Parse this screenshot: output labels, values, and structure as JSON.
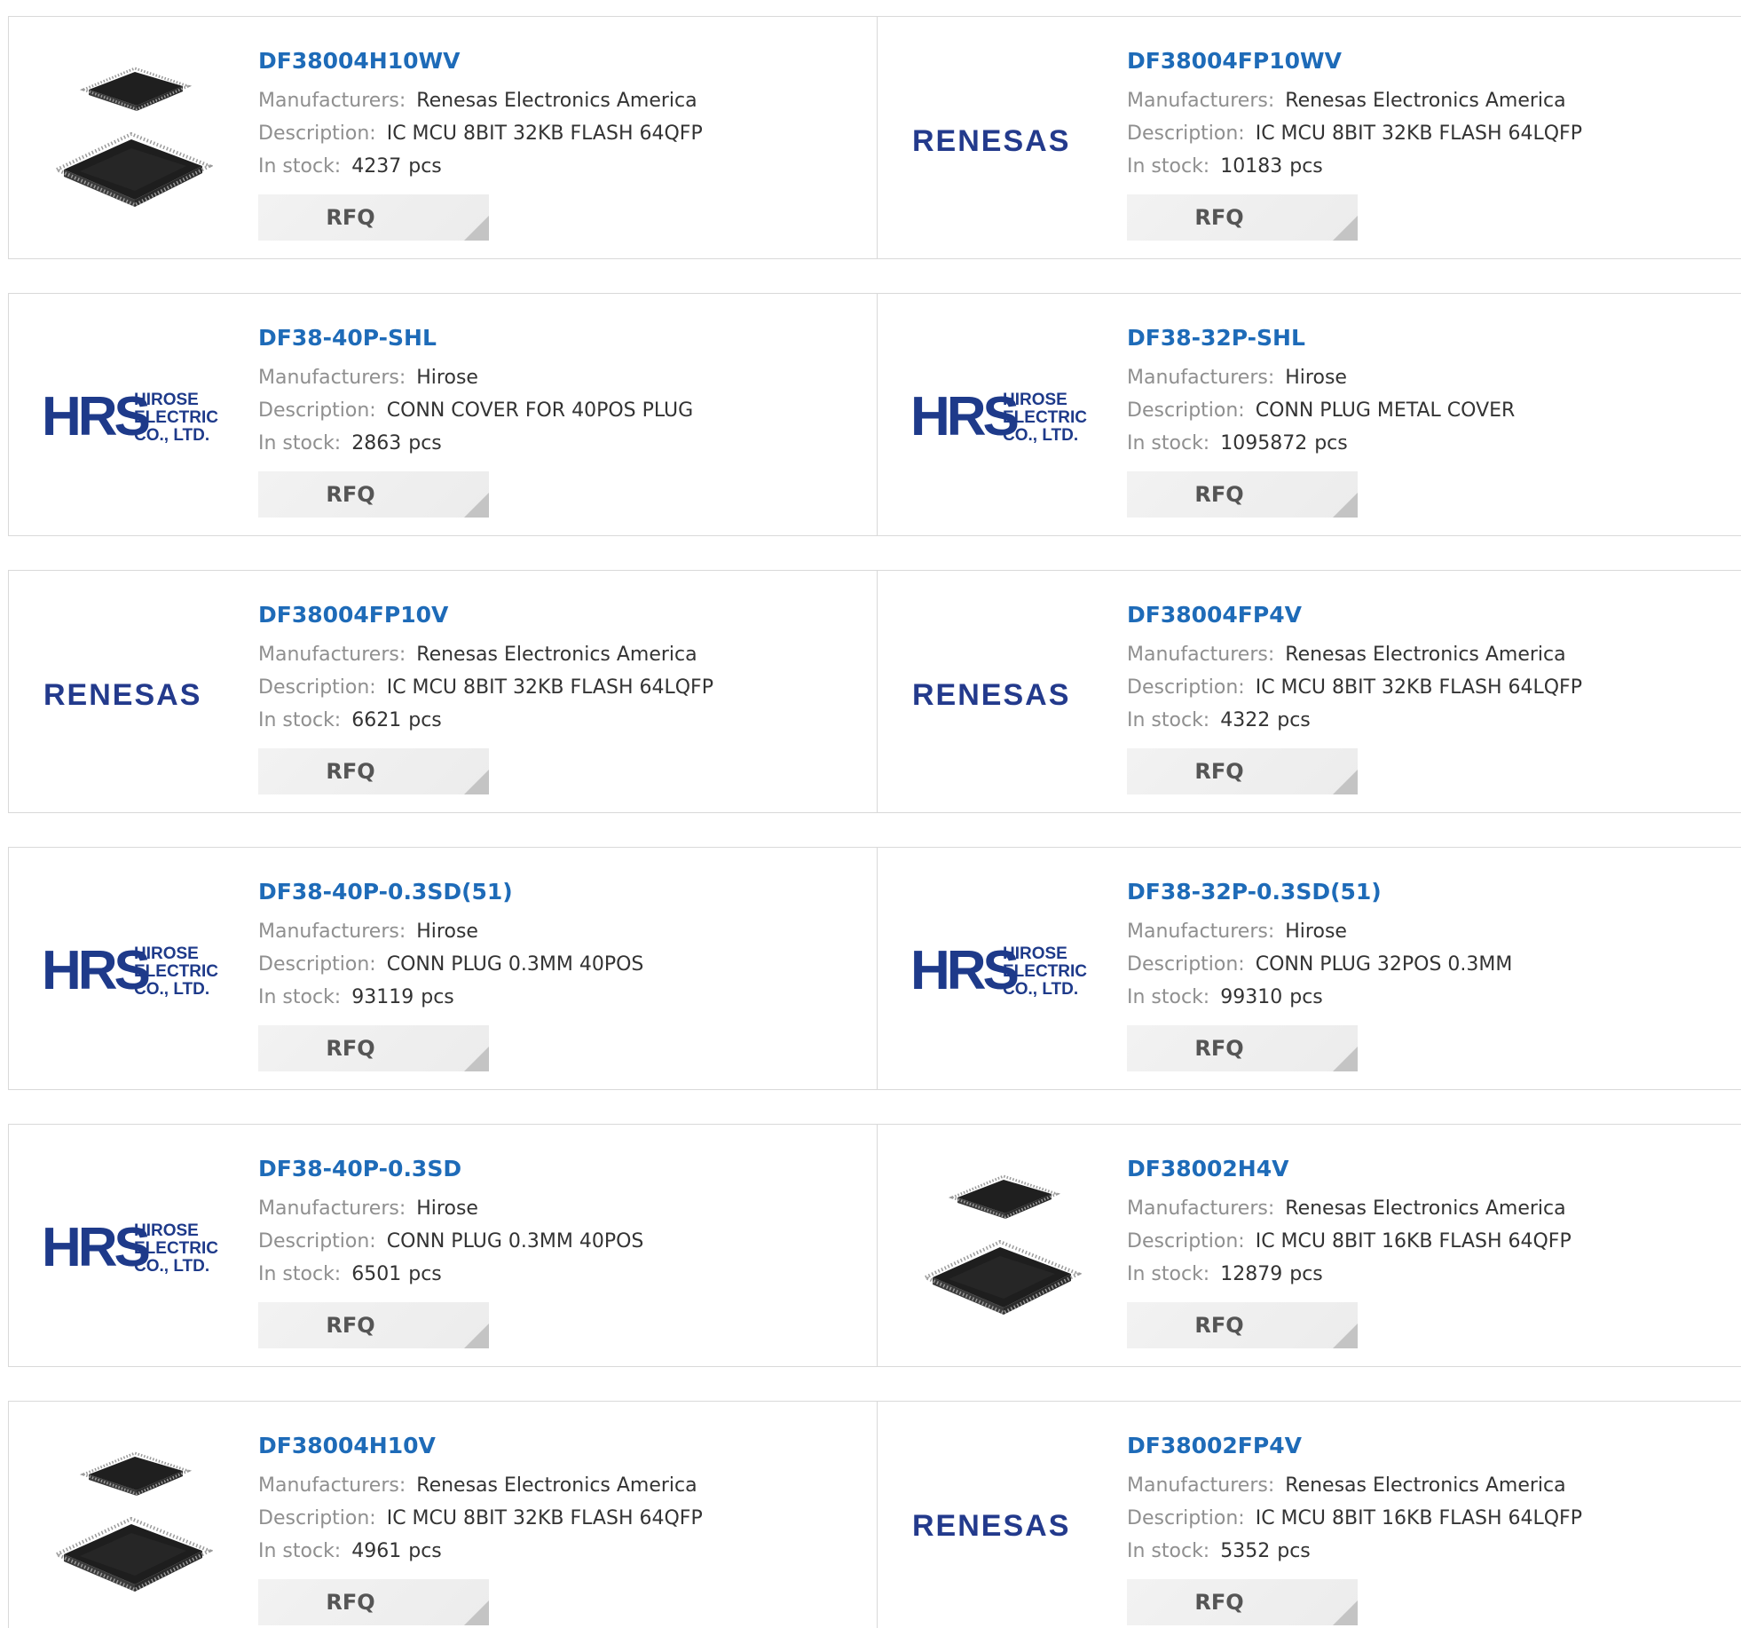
{
  "labels": {
    "manufacturers": "Manufacturers:",
    "description": "Description:",
    "in_stock": "In stock:",
    "rfq": "RFQ",
    "pcs": "pcs"
  },
  "logos": {
    "hrs": {
      "mark": "HRS",
      "line1": "HIROSE",
      "line2": "ELECTRIC",
      "line3": "CO., LTD.",
      "color": "#1e3a8a"
    },
    "renesas": {
      "text": "RENESAS",
      "color": "#233a8c"
    }
  },
  "colors": {
    "part_link": "#1e6bb8",
    "label": "#8f8f8f",
    "value": "#333333",
    "border": "#d9d9d9",
    "button_bg": "#f0f0f0"
  },
  "products": [
    {
      "part": "DF38004H10WV",
      "manufacturer": "Renesas Electronics America",
      "description": "IC MCU 8BIT 32KB FLASH 64QFP",
      "stock": "4237",
      "image": "chip-photo"
    },
    {
      "part": "DF38004FP10WV",
      "manufacturer": "Renesas Electronics America",
      "description": "IC MCU 8BIT 32KB FLASH 64LQFP",
      "stock": "10183",
      "image": "renesas-logo"
    },
    {
      "part": "DF38-40P-SHL",
      "manufacturer": "Hirose",
      "description": "CONN COVER FOR 40POS PLUG",
      "stock": "2863",
      "image": "hrs-logo"
    },
    {
      "part": "DF38-32P-SHL",
      "manufacturer": "Hirose",
      "description": "CONN PLUG METAL COVER",
      "stock": "1095872",
      "image": "hrs-logo"
    },
    {
      "part": "DF38004FP10V",
      "manufacturer": "Renesas Electronics America",
      "description": "IC MCU 8BIT 32KB FLASH 64LQFP",
      "stock": "6621",
      "image": "renesas-logo"
    },
    {
      "part": "DF38004FP4V",
      "manufacturer": "Renesas Electronics America",
      "description": "IC MCU 8BIT 32KB FLASH 64LQFP",
      "stock": "4322",
      "image": "renesas-logo"
    },
    {
      "part": "DF38-40P-0.3SD(51)",
      "manufacturer": "Hirose",
      "description": "CONN PLUG 0.3MM 40POS",
      "stock": "93119",
      "image": "hrs-logo"
    },
    {
      "part": "DF38-32P-0.3SD(51)",
      "manufacturer": "Hirose",
      "description": "CONN PLUG 32POS 0.3MM",
      "stock": "99310",
      "image": "hrs-logo"
    },
    {
      "part": "DF38-40P-0.3SD",
      "manufacturer": "Hirose",
      "description": "CONN PLUG 0.3MM 40POS",
      "stock": "6501",
      "image": "hrs-logo"
    },
    {
      "part": "DF38002H4V",
      "manufacturer": "Renesas Electronics America",
      "description": "IC MCU 8BIT 16KB FLASH 64QFP",
      "stock": "12879",
      "image": "chip-photo"
    },
    {
      "part": "DF38004H10V",
      "manufacturer": "Renesas Electronics America",
      "description": "IC MCU 8BIT 32KB FLASH 64QFP",
      "stock": "4961",
      "image": "chip-photo"
    },
    {
      "part": "DF38002FP4V",
      "manufacturer": "Renesas Electronics America",
      "description": "IC MCU 8BIT 16KB FLASH 64LQFP",
      "stock": "5352",
      "image": "renesas-logo"
    }
  ]
}
